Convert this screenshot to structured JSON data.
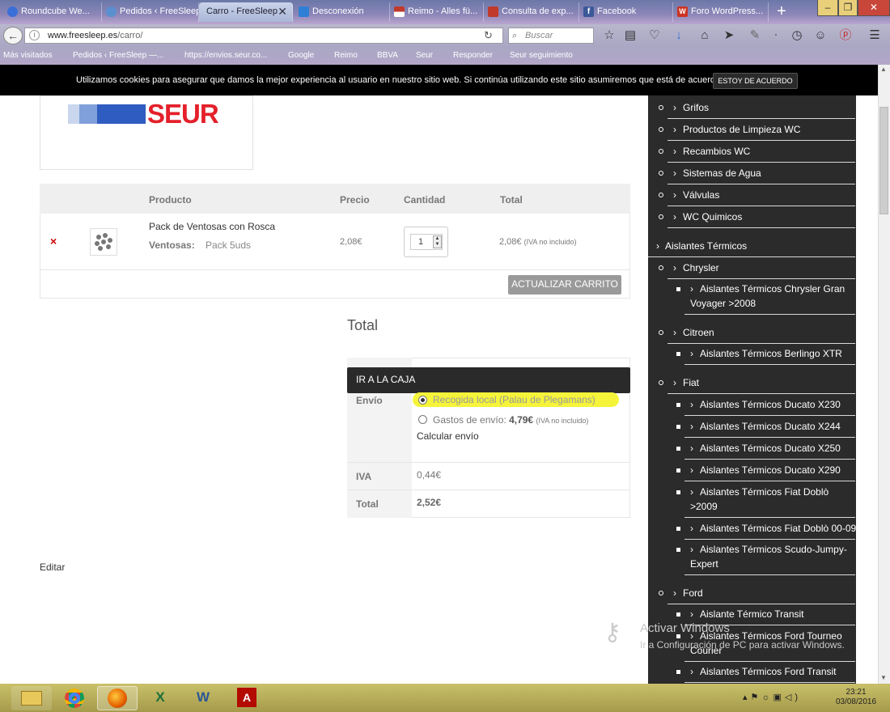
{
  "browser": {
    "tabs": [
      {
        "label": "Roundcube We...",
        "icon_color": "#3a6fd8",
        "icon": "roundcube-icon"
      },
      {
        "label": "Pedidos ‹ FreeSleep ...",
        "icon_color": "#5a8fd0",
        "icon": "globe-icon"
      },
      {
        "label": "Carro - FreeSleep",
        "icon_color": "#888888",
        "icon": "page-icon"
      },
      {
        "label": "Desconexión",
        "icon_color": "#2f7fd6",
        "icon": "page-icon"
      },
      {
        "label": "Reimo - Alles fü...",
        "icon_color": "#c0392b",
        "icon": "flag-icon"
      },
      {
        "label": "Consulta de exp...",
        "icon_color": "#c0392b",
        "icon": "seur-icon"
      },
      {
        "label": "Facebook",
        "icon_color": "#3b5998",
        "icon": "facebook-icon"
      },
      {
        "label": "Foro WordPress...",
        "icon_color": "#cc3322",
        "icon": "wordpress-icon"
      }
    ],
    "new_tab": "+",
    "url_host": "www.freesleep.es",
    "url_path": "/carro/",
    "search_placeholder": "Buscar",
    "bookmarks": [
      "Más visitados",
      "Pedidos ‹ FreeSleep —...",
      "https://envios.seur.co...",
      "Google",
      "Reimo",
      "BBVA",
      "Seur",
      "Responder",
      "Seur seguimiento"
    ]
  },
  "cookie": {
    "text": "Utilizamos cookies para asegurar que damos la mejor experiencia al usuario en nuestro sitio web. Si continúa utilizando este sitio asumiremos que está de acuerdo.",
    "button": "ESTOY DE ACUERDO"
  },
  "logo": {
    "text": "SEUR"
  },
  "cart": {
    "headers": {
      "product": "Producto",
      "price": "Precio",
      "quantity": "Cantidad",
      "total": "Total"
    },
    "item": {
      "remove": "×",
      "name": "Pack de Ventosas con Rosca",
      "variant_label": "Ventosas:",
      "variant_value": "Pack 5uds",
      "price": "2,08€",
      "quantity": "1",
      "total": "2,08€",
      "total_note": "(IVA no incluido)"
    },
    "update_button": "ACTUALIZAR CARRITO"
  },
  "totals": {
    "title": "Total",
    "checkout_button": "IR A LA CAJA",
    "shipping_label": "Envío",
    "shipping_options": [
      {
        "label": "Recogida local (Palau de Plegamans)",
        "selected": true
      },
      {
        "label": "Gastos de envío:",
        "amount": "4,79€",
        "note": "(IVA no incluido)",
        "selected": false
      }
    ],
    "calc_shipping": "Calcular envío",
    "tax_label": "IVA",
    "tax_value": "0,44€",
    "total_label": "Total",
    "total_value": "2,52€"
  },
  "edit_link": "Editar",
  "sidebar": {
    "items": [
      {
        "label": "Grifos",
        "level": 2
      },
      {
        "label": "Productos de Limpieza WC",
        "level": 2
      },
      {
        "label": "Recambios WC",
        "level": 2
      },
      {
        "label": "Sistemas de Agua",
        "level": 2
      },
      {
        "label": "Válvulas",
        "level": 2
      },
      {
        "label": "WC Quimicos",
        "level": 2
      },
      {
        "label": "Aislantes Térmicos",
        "level": 1
      },
      {
        "label": "Chrysler",
        "level": 2
      },
      {
        "label": "Aislantes Térmicos Chrysler Gran",
        "label2": "Voyager >2008",
        "level": 3
      },
      {
        "label": "Citroen",
        "level": 2
      },
      {
        "label": "Aislantes Térmicos Berlingo XTR",
        "level": 3
      },
      {
        "label": "Fiat",
        "level": 2
      },
      {
        "label": "Aislantes Térmicos Ducato X230",
        "level": 3
      },
      {
        "label": "Aislantes Térmicos Ducato X244",
        "level": 3
      },
      {
        "label": "Aislantes Térmicos Ducato X250",
        "level": 3
      },
      {
        "label": "Aislantes Térmicos Ducato X290",
        "level": 3
      },
      {
        "label": "Aislantes Térmicos Fiat Doblò",
        "label2": ">2009",
        "level": 3
      },
      {
        "label": "Aislantes Térmicos Fiat Doblò 00-09",
        "level": 3
      },
      {
        "label": "Aislantes Térmicos Scudo-Jumpy-",
        "label2": "Expert",
        "level": 3
      },
      {
        "label": "Ford",
        "level": 2
      },
      {
        "label": "Aislante Térmico Transit",
        "level": 3
      },
      {
        "label": "Aislantes Térmicos Ford Tourneo",
        "label2": "Courier",
        "level": 3
      },
      {
        "label": "Aislantes Térmicos Ford Transit",
        "level": 3
      }
    ]
  },
  "watermark": {
    "line1": "Activar Windows",
    "line2": "Ir a Configuración de PC para activar Windows."
  },
  "taskbar": {
    "time": "23:21",
    "date": "03/08/2016",
    "apps": [
      "explorer-icon",
      "chrome-icon",
      "firefox-icon",
      "excel-icon",
      "word-icon",
      "acrobat-icon"
    ]
  }
}
